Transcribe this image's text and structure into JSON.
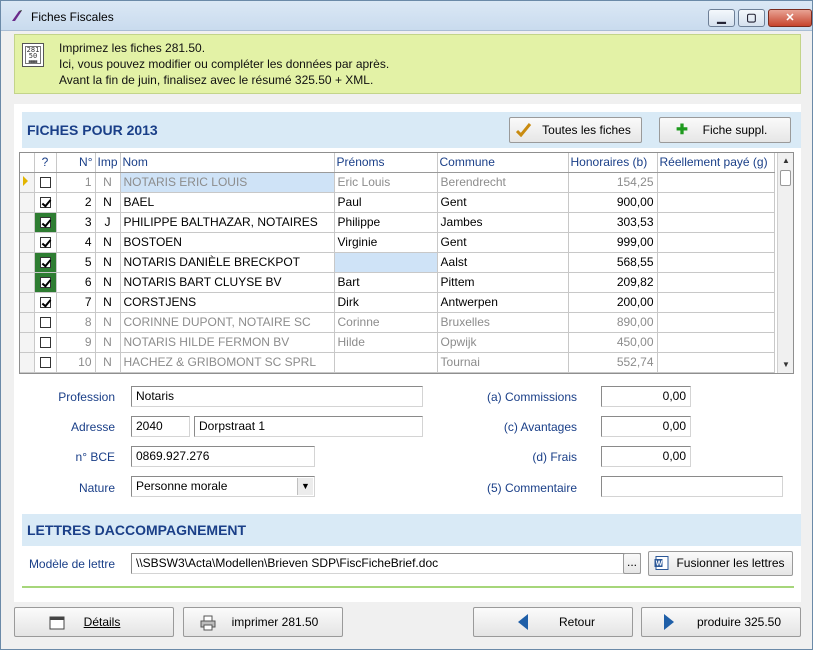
{
  "window": {
    "title": "Fiches Fiscales"
  },
  "info": {
    "icon": "calendar-281-icon",
    "icon_text": "281\n50",
    "lines": [
      "Imprimez les fiches 281.50.",
      "Ici, vous pouvez modifier ou compléter les données par après.",
      "Avant la fin de juin, finalisez avec le résumé 325.50 + XML."
    ]
  },
  "fiches": {
    "title": "FICHES POUR 2013",
    "btn_all": "Toutes les fiches",
    "btn_extra": "Fiche suppl.",
    "columns": [
      "?",
      "N°",
      "Imp",
      "Nom",
      "Prénoms",
      "Commune",
      "Honoraires (b)",
      "Réellement payé (g)"
    ],
    "rows": [
      {
        "checked": false,
        "green": false,
        "gray": true,
        "no": "1",
        "imp": "N",
        "nom": "NOTARIS ERIC LOUIS",
        "prenom": "Eric Louis",
        "commune": "Berendrecht",
        "honoraires": "154,25",
        "paye": ""
      },
      {
        "checked": true,
        "green": false,
        "gray": false,
        "no": "2",
        "imp": "N",
        "nom": "BAEL",
        "prenom": "Paul",
        "commune": "Gent",
        "honoraires": "900,00",
        "paye": ""
      },
      {
        "checked": true,
        "green": true,
        "gray": false,
        "no": "3",
        "imp": "J",
        "nom": "PHILIPPE BALTHAZAR, NOTAIRES",
        "prenom": "Philippe",
        "commune": "Jambes",
        "honoraires": "303,53",
        "paye": ""
      },
      {
        "checked": true,
        "green": false,
        "gray": false,
        "no": "4",
        "imp": "N",
        "nom": "BOSTOEN",
        "prenom": "Virginie",
        "commune": "Gent",
        "honoraires": "999,00",
        "paye": ""
      },
      {
        "checked": true,
        "green": true,
        "gray": false,
        "no": "5",
        "imp": "N",
        "nom": "NOTARIS DANIÈLE BRECKPOT",
        "prenom": "",
        "commune": "Aalst",
        "honoraires": "568,55",
        "paye": ""
      },
      {
        "checked": true,
        "green": true,
        "gray": false,
        "no": "6",
        "imp": "N",
        "nom": "NOTARIS BART CLUYSE BV",
        "prenom": "Bart",
        "commune": "Pittem",
        "honoraires": "209,82",
        "paye": ""
      },
      {
        "checked": true,
        "green": false,
        "gray": false,
        "no": "7",
        "imp": "N",
        "nom": "CORSTJENS",
        "prenom": "Dirk",
        "commune": "Antwerpen",
        "honoraires": "200,00",
        "paye": ""
      },
      {
        "checked": false,
        "green": false,
        "gray": true,
        "no": "8",
        "imp": "N",
        "nom": "CORINNE DUPONT, NOTAIRE SC",
        "prenom": "Corinne",
        "commune": "Bruxelles",
        "honoraires": "890,00",
        "paye": ""
      },
      {
        "checked": false,
        "green": false,
        "gray": true,
        "no": "9",
        "imp": "N",
        "nom": "NOTARIS HILDE FERMON BV",
        "prenom": "Hilde",
        "commune": "Opwijk",
        "honoraires": "450,00",
        "paye": ""
      },
      {
        "checked": false,
        "green": false,
        "gray": true,
        "no": "10",
        "imp": "N",
        "nom": "HACHEZ & GRIBOMONT SC SPRL",
        "prenom": "",
        "commune": "Tournai",
        "honoraires": "552,74",
        "paye": ""
      }
    ]
  },
  "detail": {
    "profession_label": "Profession",
    "profession": "Notaris",
    "adresse_label": "Adresse",
    "postcode": "2040",
    "street": "Dorpstraat 1",
    "bce_label": "n° BCE",
    "bce": "0869.927.276",
    "nature_label": "Nature",
    "nature": "Personne morale",
    "commissions_label": "(a) Commissions",
    "commissions": "0,00",
    "avantages_label": "(c) Avantages",
    "avantages": "0,00",
    "frais_label": "(d) Frais",
    "frais": "0,00",
    "commentaire_label": "(5) Commentaire",
    "commentaire": ""
  },
  "lettres": {
    "title": "LETTRES DACCOMPAGNEMENT",
    "modele_label": "Modèle de lettre",
    "modele": "\\\\SBSW3\\Acta\\Modellen\\Brieven SDP\\FiscFicheBrief.doc",
    "browse": "...",
    "merge": "Fusionner les lettres"
  },
  "footer": {
    "details": "Détails",
    "print": "imprimer 281.50",
    "back": "Retour",
    "produce": "produire 325.50"
  },
  "colors": {
    "accent": "#1a3f88",
    "info_bg": "#e3f2a6",
    "section_bg": "#d9eaf6",
    "checked_green": "#2e7d32"
  }
}
